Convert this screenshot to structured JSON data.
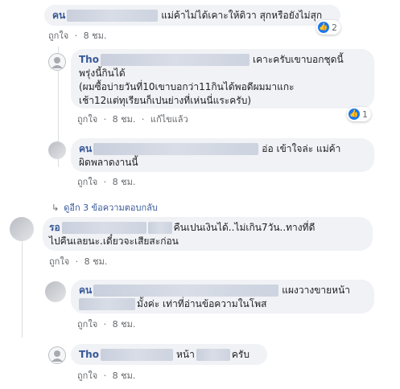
{
  "meta_labels": {
    "like": "ถูกใจ",
    "sep": "·",
    "edited": "แก้ไขแล้ว"
  },
  "comments": [
    {
      "name": "คน",
      "text": "แม่ค้าไม่ได้เคาะให้ดิวา สุกหรือยังไม่สุก",
      "time": "8 ชม.",
      "reactions": "2"
    },
    {
      "name": "Tho",
      "text_line1": "เคาะครับเขาบอกชุดนี้",
      "text_line2": "พรุ่งนี้กินได้",
      "text_line3": "(ผมซื้อบ่ายวันที่10เขาบอกว่า11กินได้พอดีผมมาแกะ",
      "text_line4": "เช้า12แต่ทุเรียนก็เปนย่างที่เห่นนี่แระครับ)",
      "time": "8 ชม.",
      "reactions": "1"
    },
    {
      "name": "คน",
      "text_line1": "อ่อ เข้าใจล่ะ แม่ค้า",
      "text_line2": "ผิดพลาดงานนี้",
      "time": "8 ชม."
    },
    {
      "more": "ดูอีก 3 ข้อความตอบกลับ"
    },
    {
      "name": "รอ",
      "text_line1": "คืนเปนเงินได้..ไม่เกิน7วัน..ทางที่ดี",
      "text_line2": "ไปคืนเลยนะ.เดี๋ยวจะเสียสะก่อน",
      "time": "8 ชม."
    },
    {
      "name": "คน",
      "text_line1": "แผงวางขายหน้า",
      "text_line2": "มั้งค่ะ เท่าที่อ่านข้อความในโพส",
      "time": "8 ชม."
    },
    {
      "name": "Tho",
      "text": "หน้า",
      "text_tail": "ครับ",
      "time": "8 ชม."
    }
  ]
}
